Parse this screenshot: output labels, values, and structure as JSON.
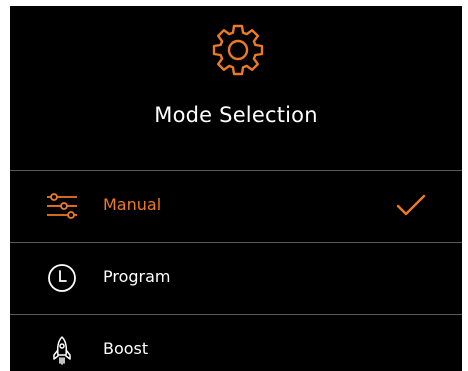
{
  "colors": {
    "accent": "#ec7a25",
    "background": "#000000",
    "text": "#ffffff",
    "divider": "#5a5a5a"
  },
  "header": {
    "icon": "gear-icon",
    "title": "Mode Selection"
  },
  "modes": [
    {
      "label": "Manual",
      "icon": "sliders-icon",
      "selected": true
    },
    {
      "label": "Program",
      "icon": "clock-icon",
      "selected": false
    },
    {
      "label": "Boost",
      "icon": "rocket-icon",
      "selected": false
    }
  ],
  "selected_indicator": "checkmark-icon"
}
